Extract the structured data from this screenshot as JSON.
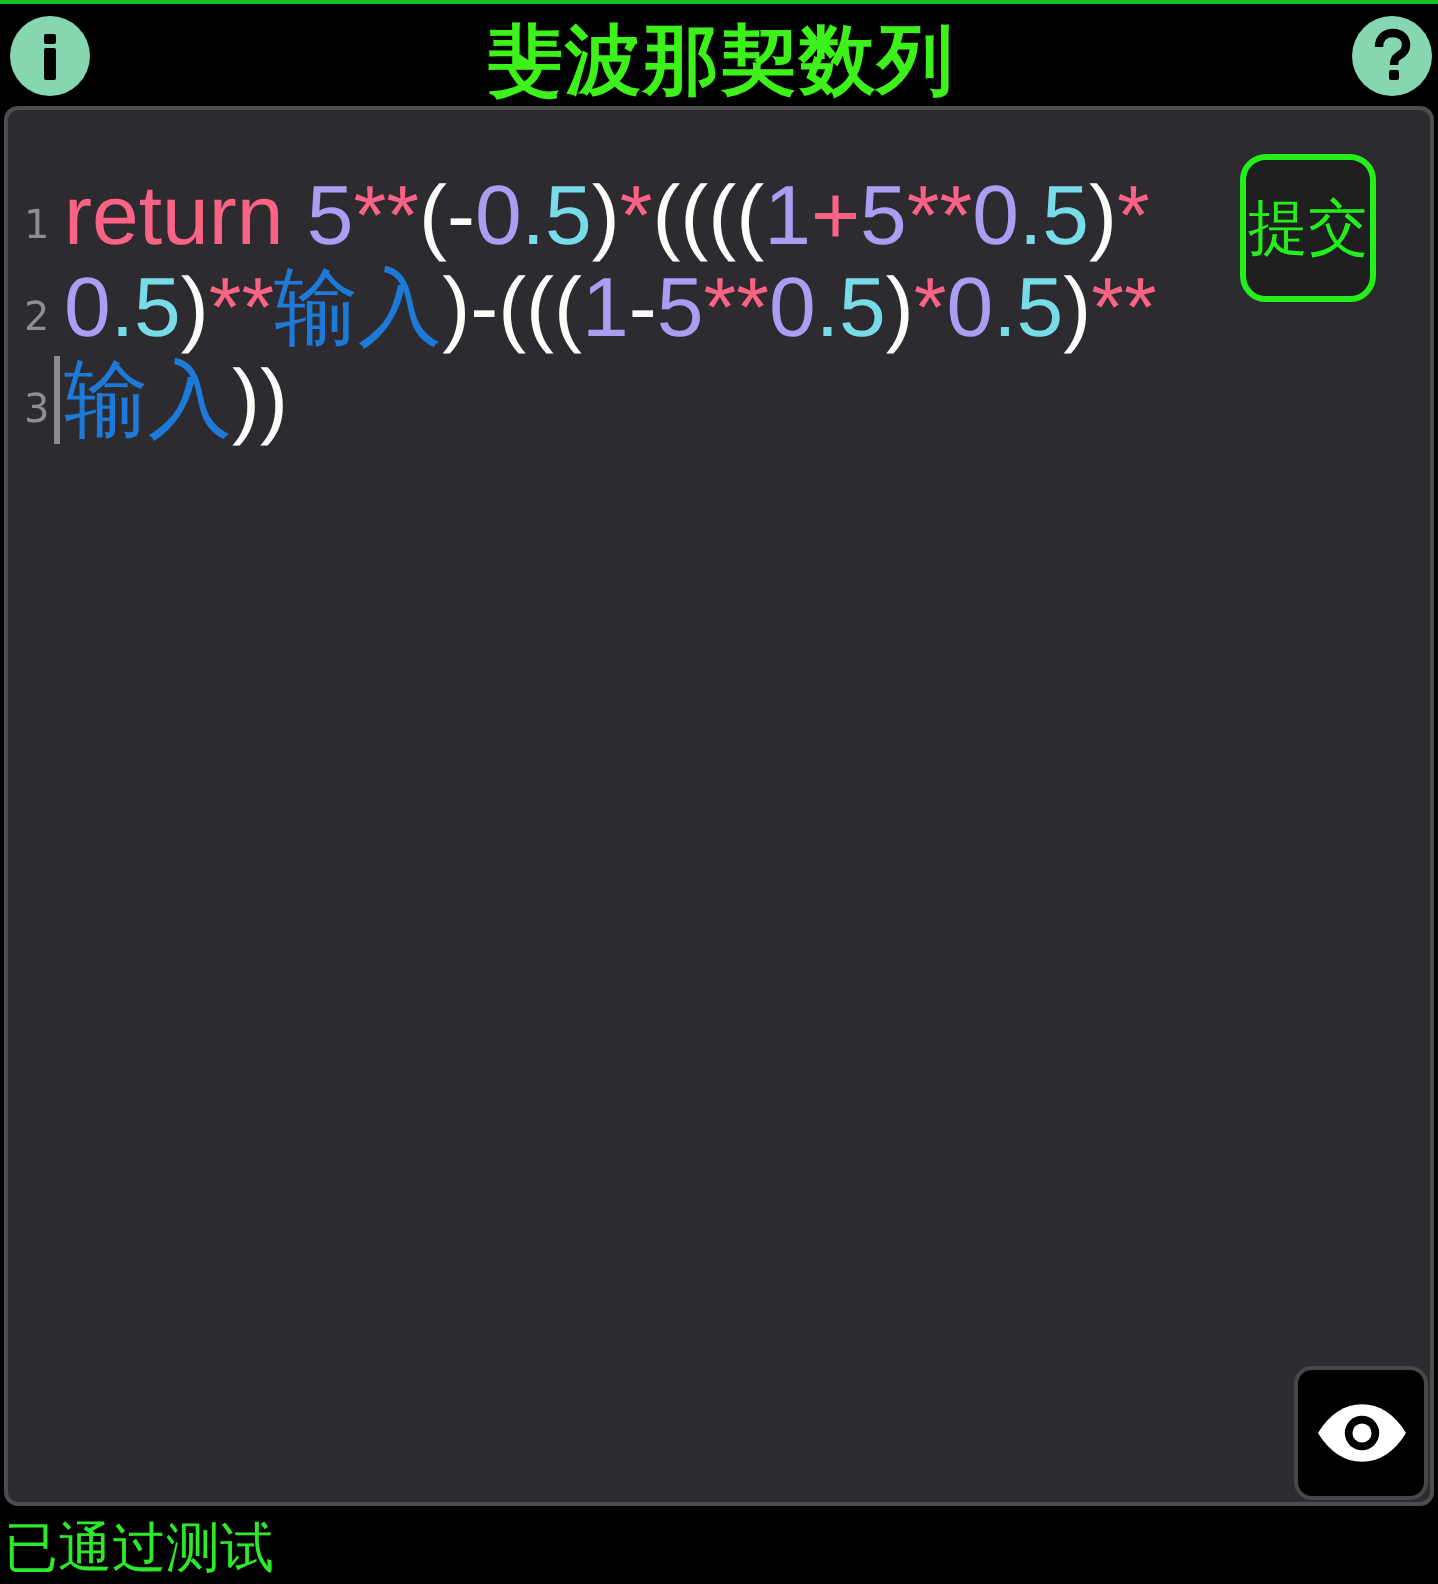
{
  "header": {
    "title": "斐波那契数列"
  },
  "editor": {
    "lines": [
      {
        "number": "1",
        "cursor": false,
        "tokens": [
          {
            "kind": "keyword",
            "text": "return "
          },
          {
            "kind": "number",
            "text": "5"
          },
          {
            "kind": "operator",
            "text": "**"
          },
          {
            "kind": "punct",
            "text": "(-"
          },
          {
            "kind": "number",
            "text": "0"
          },
          {
            "kind": "fraction",
            "text": ".5"
          },
          {
            "kind": "punct",
            "text": ")"
          },
          {
            "kind": "operator",
            "text": "*"
          },
          {
            "kind": "punct",
            "text": "(((("
          },
          {
            "kind": "number",
            "text": "1"
          },
          {
            "kind": "operator",
            "text": "+"
          },
          {
            "kind": "number",
            "text": "5"
          },
          {
            "kind": "operator",
            "text": "**"
          },
          {
            "kind": "number",
            "text": "0"
          },
          {
            "kind": "fraction",
            "text": ".5"
          },
          {
            "kind": "punct",
            "text": ")"
          },
          {
            "kind": "operator",
            "text": "*"
          }
        ]
      },
      {
        "number": "2",
        "cursor": false,
        "tokens": [
          {
            "kind": "number",
            "text": "0"
          },
          {
            "kind": "fraction",
            "text": ".5"
          },
          {
            "kind": "punct",
            "text": ")"
          },
          {
            "kind": "operator",
            "text": "**"
          },
          {
            "kind": "identifier",
            "text": "输入"
          },
          {
            "kind": "punct",
            "text": ")-((("
          },
          {
            "kind": "number",
            "text": "1"
          },
          {
            "kind": "punct",
            "text": "-"
          },
          {
            "kind": "number",
            "text": "5"
          },
          {
            "kind": "operator",
            "text": "**"
          },
          {
            "kind": "number",
            "text": "0"
          },
          {
            "kind": "fraction",
            "text": ".5"
          },
          {
            "kind": "punct",
            "text": ")"
          },
          {
            "kind": "operator",
            "text": "*"
          },
          {
            "kind": "number",
            "text": "0"
          },
          {
            "kind": "fraction",
            "text": ".5"
          },
          {
            "kind": "punct",
            "text": ")"
          },
          {
            "kind": "operator",
            "text": "**"
          }
        ]
      },
      {
        "number": "3",
        "cursor": true,
        "tokens": [
          {
            "kind": "identifier",
            "text": "输入"
          },
          {
            "kind": "punct",
            "text": "))"
          }
        ]
      }
    ]
  },
  "submit_button": {
    "label": "提交"
  },
  "status": {
    "text": "已通过测试"
  }
}
